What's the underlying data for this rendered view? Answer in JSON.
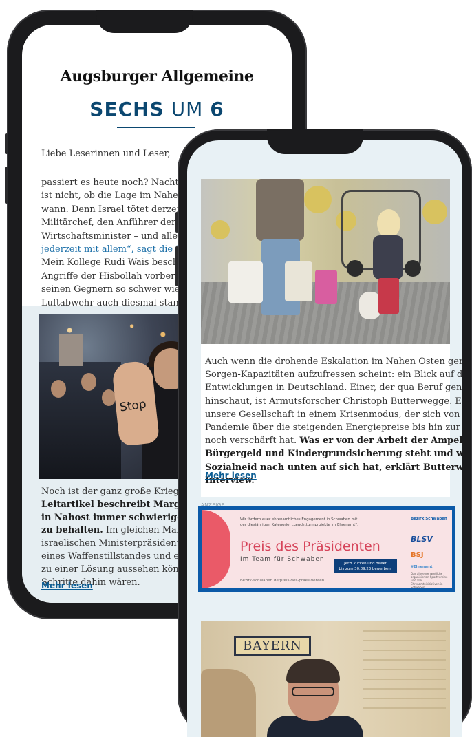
{
  "back_phone": {
    "brand": "Augsburger Allgemeine",
    "newsletter": {
      "word1": "SECHS",
      "word2": "UM",
      "word3": "6"
    },
    "greeting": "Liebe Leserinnen und Leser,",
    "paragraph1_lines": [
      "passiert es heute noch? Nachts oder am f",
      "ist nicht, ob die Lage im Nahen Osten we",
      "wann. Denn Israel tötet derzeit gezielt Ha",
      "Militärchef, den Anführer der Terrormili",
      "Wirtschaftsminister – und alle warten au"
    ],
    "paragraph1_link": "jederzeit mit allem“, sagt die israelische F",
    "paragraph1_rest": [
      "Mein Kollege Rudi Wais beschreibt, wie s",
      "Angriffe der Hisbollah vorbereiten und w",
      "seinen Gegnern so schwer wie möglich z",
      "Luftabwehr auch diesmal standhält?"
    ],
    "photo_sign_text": "Stop",
    "paragraph2_line1": "Noch ist der ganz große Krieg nicht ausg",
    "paragraph2_bold": [
      "Leitartikel beschreibt Margit Hufnagel, w",
      "in Nahost immer schwieriger wird, die Ko",
      "zu behalten."
    ],
    "paragraph2_tail": " Im gleichen Maße, wie das M",
    "paragraph2_rest": [
      "israelischen Ministerpräsidenten wächst",
      "eines Waffenstillstandes und eines Geisel",
      "zu einer Lösung aussehen könnte – und v",
      "Schritte dahin wären."
    ],
    "read_more": "Mehr lesen"
  },
  "front_phone": {
    "article_lines": [
      "Auch wenn die drohende Eskalation im Nahen Osten gerade die",
      "Sorgen-Kapazitäten aufzufressen scheint: ein Blick auf die",
      "Entwicklungen in Deutschland. Einer, der qua Beruf genau",
      "hinschaut, ist Armutsforscher Christoph Butterwegge. Er sieht",
      "unsere Gesellschaft in einem Krisenmodus, der sich von der Corona-",
      "Pandemie über die steigenden Energiepreise bis hin zur Inflation"
    ],
    "article_mixed_normal": "noch verschärft hat. ",
    "article_mixed_bold": "Was er von der Arbeit der Ampel hält, wie er zu",
    "article_bold_lines": [
      "Bürgergeld und Kindergrundsicherung steht und was es mit dem",
      "Sozialneid nach unten auf sich hat, erklärt Butterwegge im",
      "Interview."
    ],
    "read_more": "Mehr lesen",
    "ad_label": "ANZEIGE",
    "ad": {
      "small_line1": "Wir fördern euer ehrenamtliches Engagement in Schwaben mit",
      "small_line2": "der diesjährigen Kategorie: „Leuchtturmprojekte im Ehrenamt“.",
      "title": "Preis des Präsidenten",
      "subtitle": "Im Team für Schwaben",
      "cta_line1": "Jetzt klicken und direkt",
      "cta_line2": "bis zum 30.09.23 bewerben.",
      "url": "bezirk-schwaben.de/preis-des-praesidenten",
      "logo1": "Bezirk Schwaben",
      "logo2": "BLSV",
      "logo3": "BSJ",
      "logo4": "#Ehrenamt",
      "logo_small": "Das alle ehrenamtliche organisierten Sportvereine und alle Ehrenamtsinitiativen in Schwaben"
    },
    "photo2_sign": "BAYERN"
  }
}
